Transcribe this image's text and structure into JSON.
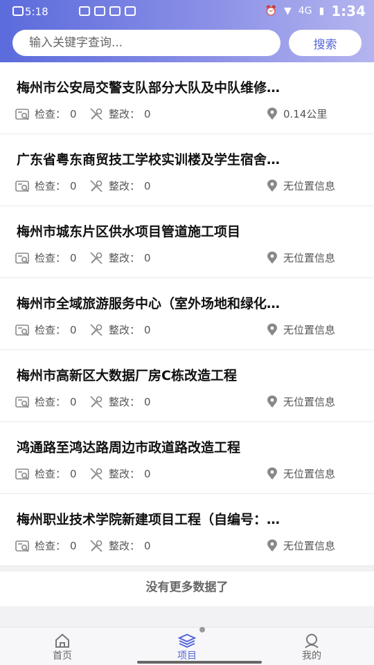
{
  "status_bar": {
    "time": "5:18",
    "network": "4G",
    "clock": "1:34"
  },
  "search": {
    "placeholder": "输入关键字查询...",
    "button_label": "搜索"
  },
  "labels": {
    "check": "检查：",
    "rectify": "整改："
  },
  "projects": [
    {
      "title": "梅州市公安局交警支队部分大队及中队维修…",
      "check_count": "0",
      "rectify_count": "0",
      "location": "0.14公里"
    },
    {
      "title": "广东省粤东商贸技工学校实训楼及学生宿舍…",
      "check_count": "0",
      "rectify_count": "0",
      "location": "无位置信息"
    },
    {
      "title": "梅州市城东片区供水项目管道施工项目",
      "check_count": "0",
      "rectify_count": "0",
      "location": "无位置信息"
    },
    {
      "title": "梅州市全域旅游服务中心（室外场地和绿化…",
      "check_count": "0",
      "rectify_count": "0",
      "location": "无位置信息"
    },
    {
      "title": "梅州市高新区大数据厂房C栋改造工程",
      "check_count": "0",
      "rectify_count": "0",
      "location": "无位置信息"
    },
    {
      "title": "鸿通路至鸿达路周边市政道路改造工程",
      "check_count": "0",
      "rectify_count": "0",
      "location": "无位置信息"
    },
    {
      "title": "梅州职业技术学院新建项目工程（自编号：…",
      "check_count": "0",
      "rectify_count": "0",
      "location": "无位置信息"
    }
  ],
  "footer_text": "没有更多数据了",
  "tabs": [
    {
      "label": "首页",
      "icon": "home-icon"
    },
    {
      "label": "项目",
      "icon": "layers-icon"
    },
    {
      "label": "我的",
      "icon": "user-icon"
    }
  ],
  "colors": {
    "accent": "#5566d8",
    "header_start": "#5b6bdc",
    "header_end": "#b4b5ef"
  }
}
